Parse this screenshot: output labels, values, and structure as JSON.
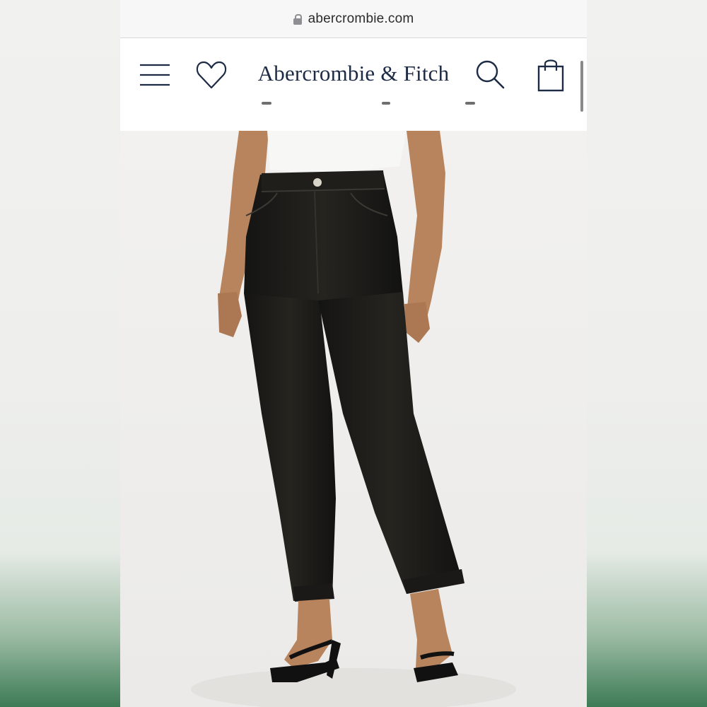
{
  "browser": {
    "url": "abercrombie.com",
    "lock_icon": "lock-icon"
  },
  "header": {
    "brand": "Abercrombie & Fitch",
    "icons": [
      "menu-icon",
      "heart-icon",
      "search-icon",
      "shopping-bag-icon"
    ],
    "brand_color": "#1d2b45"
  },
  "product": {
    "image_subject": "black high-rise straight ankle jeans with white bodysuit and black sandals",
    "colors": {
      "denim": "#1c1b1a",
      "background": "#f3f2f0"
    }
  }
}
